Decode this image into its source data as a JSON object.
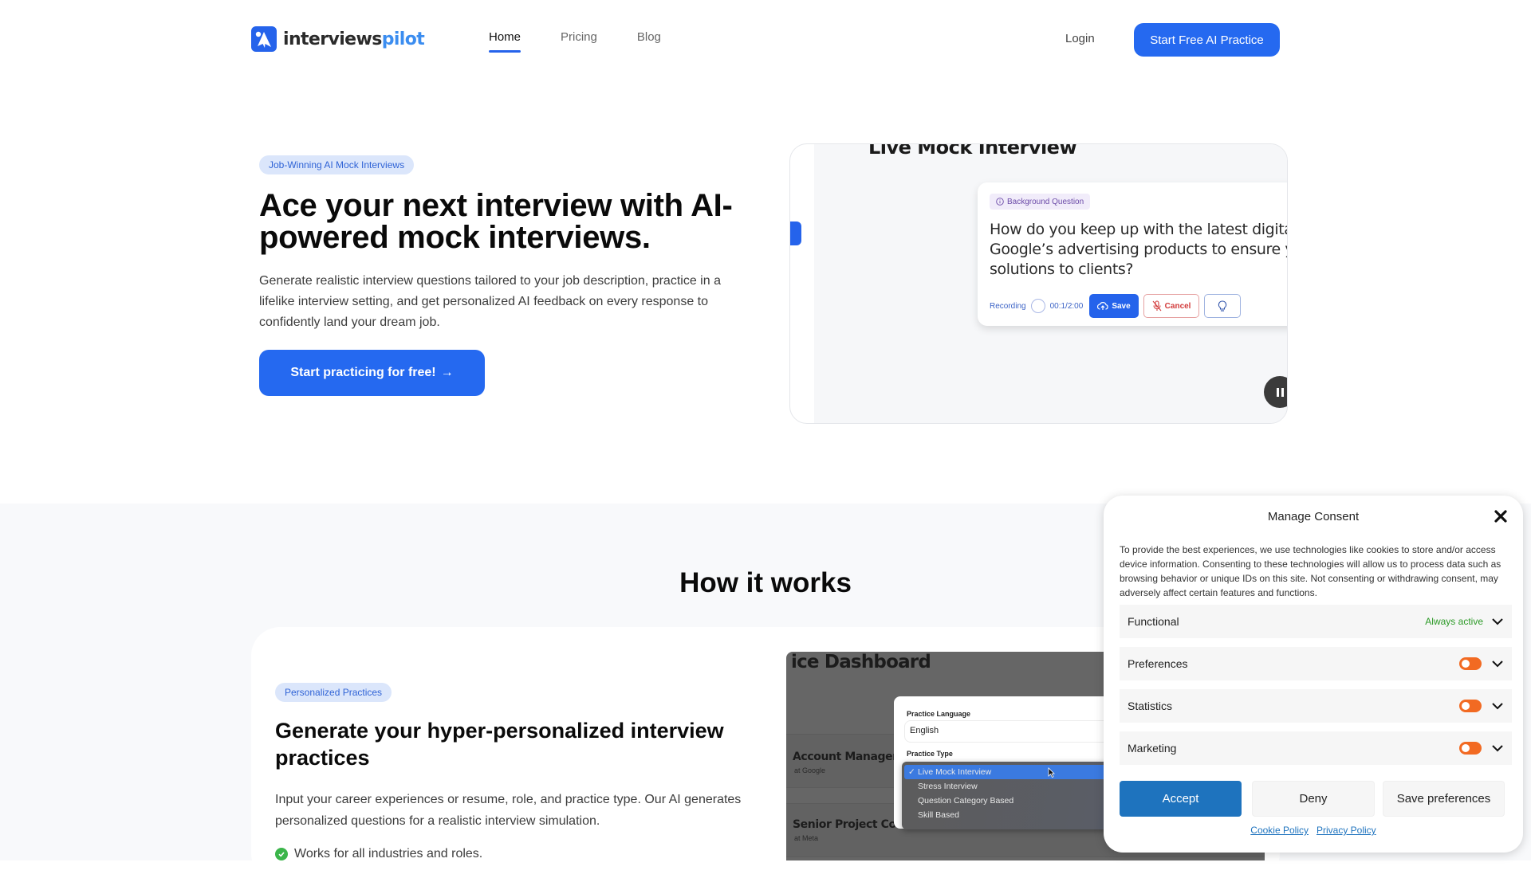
{
  "header": {
    "logo": {
      "part1": "interviews",
      "part2": "pilot",
      "icon": "paper-plane-logo-icon"
    },
    "nav": [
      {
        "label": "Home",
        "active": true
      },
      {
        "label": "Pricing",
        "active": false
      },
      {
        "label": "Blog",
        "active": false
      }
    ],
    "login": "Login",
    "cta": "Start Free AI Practice"
  },
  "hero": {
    "badge": "Job-Winning AI Mock Interviews",
    "title": "Ace your next interview with AI-powered mock interviews.",
    "description": "Generate realistic interview questions tailored to your job description, practice in a lifelike interview setting, and get personalized AI feedback on every response to confidently land your dream job.",
    "cta": "Start practicing for free!",
    "cta_arrow": "→"
  },
  "video": {
    "heading": "Live Mock Interview",
    "question_badge": "Background Question",
    "question_lines": [
      "How do you keep up with the latest digital m",
      "Google’s advertising products to ensure you",
      "solutions to clients?"
    ],
    "recording_label": "Recording",
    "timer": "00:1/2:00",
    "save_label": "Save",
    "cancel_label": "Cancel"
  },
  "how_it_works": {
    "title": "How it works",
    "feature": {
      "badge": "Personalized Practices",
      "title": "Generate your hyper-personalized interview practices",
      "description": "Input your career experiences or resume, role, and practice type. Our AI generates personalized questions for a realistic interview simulation.",
      "bullets": [
        "Works for all industries and roles."
      ]
    },
    "dashboard": {
      "title": "ice Dashboard",
      "rows": [
        {
          "role": "Account Manager",
          "company": "at Google"
        },
        {
          "role": "Senior Project Coor",
          "company": "at Meta"
        }
      ],
      "modal": {
        "language_label": "Practice Language",
        "language_value": "English",
        "type_label": "Practice Type",
        "type_options": [
          "Live Mock Interview",
          "Stress Interview",
          "Question Category Based",
          "Skill Based"
        ],
        "type_selected": "Live Mock Interview",
        "check": "✓"
      }
    }
  },
  "consent": {
    "title": "Manage Consent",
    "text": "To provide the best experiences, we use technologies like cookies to store and/or access device information. Consenting to these technologies will allow us to process data such as browsing behavior or unique IDs on this site. Not consenting or withdrawing consent, may adversely affect certain features and functions.",
    "categories": [
      {
        "label": "Functional",
        "status": "Always active"
      },
      {
        "label": "Preferences",
        "toggle": "off"
      },
      {
        "label": "Statistics",
        "toggle": "off"
      },
      {
        "label": "Marketing",
        "toggle": "off"
      }
    ],
    "accept": "Accept",
    "deny": "Deny",
    "save": "Save preferences",
    "links": [
      "Cookie Policy",
      "Privacy Policy"
    ],
    "colors": {
      "accept": "#1e73be",
      "toggle": "#f26a22",
      "always_active": "#2c9a27"
    }
  }
}
